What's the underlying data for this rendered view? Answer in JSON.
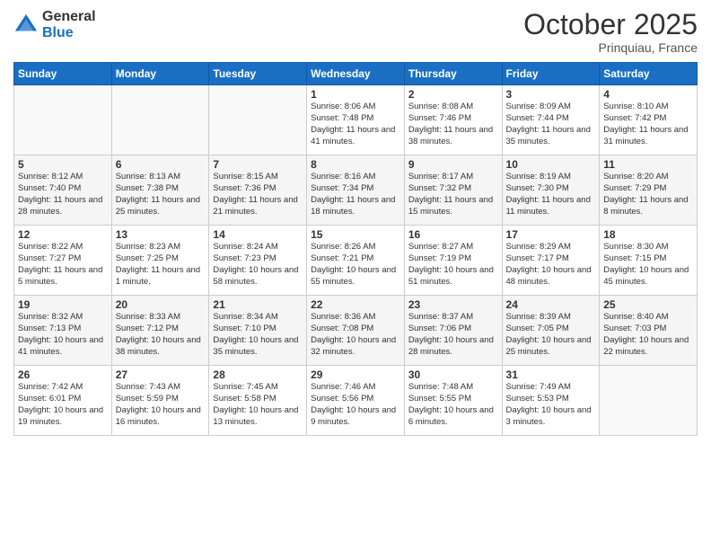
{
  "logo": {
    "general": "General",
    "blue": "Blue"
  },
  "header": {
    "month": "October 2025",
    "location": "Prinquiau, France"
  },
  "weekdays": [
    "Sunday",
    "Monday",
    "Tuesday",
    "Wednesday",
    "Thursday",
    "Friday",
    "Saturday"
  ],
  "weeks": [
    [
      {
        "day": "",
        "info": ""
      },
      {
        "day": "",
        "info": ""
      },
      {
        "day": "",
        "info": ""
      },
      {
        "day": "1",
        "info": "Sunrise: 8:06 AM\nSunset: 7:48 PM\nDaylight: 11 hours\nand 41 minutes."
      },
      {
        "day": "2",
        "info": "Sunrise: 8:08 AM\nSunset: 7:46 PM\nDaylight: 11 hours\nand 38 minutes."
      },
      {
        "day": "3",
        "info": "Sunrise: 8:09 AM\nSunset: 7:44 PM\nDaylight: 11 hours\nand 35 minutes."
      },
      {
        "day": "4",
        "info": "Sunrise: 8:10 AM\nSunset: 7:42 PM\nDaylight: 11 hours\nand 31 minutes."
      }
    ],
    [
      {
        "day": "5",
        "info": "Sunrise: 8:12 AM\nSunset: 7:40 PM\nDaylight: 11 hours\nand 28 minutes."
      },
      {
        "day": "6",
        "info": "Sunrise: 8:13 AM\nSunset: 7:38 PM\nDaylight: 11 hours\nand 25 minutes."
      },
      {
        "day": "7",
        "info": "Sunrise: 8:15 AM\nSunset: 7:36 PM\nDaylight: 11 hours\nand 21 minutes."
      },
      {
        "day": "8",
        "info": "Sunrise: 8:16 AM\nSunset: 7:34 PM\nDaylight: 11 hours\nand 18 minutes."
      },
      {
        "day": "9",
        "info": "Sunrise: 8:17 AM\nSunset: 7:32 PM\nDaylight: 11 hours\nand 15 minutes."
      },
      {
        "day": "10",
        "info": "Sunrise: 8:19 AM\nSunset: 7:30 PM\nDaylight: 11 hours\nand 11 minutes."
      },
      {
        "day": "11",
        "info": "Sunrise: 8:20 AM\nSunset: 7:29 PM\nDaylight: 11 hours\nand 8 minutes."
      }
    ],
    [
      {
        "day": "12",
        "info": "Sunrise: 8:22 AM\nSunset: 7:27 PM\nDaylight: 11 hours\nand 5 minutes."
      },
      {
        "day": "13",
        "info": "Sunrise: 8:23 AM\nSunset: 7:25 PM\nDaylight: 11 hours\nand 1 minute."
      },
      {
        "day": "14",
        "info": "Sunrise: 8:24 AM\nSunset: 7:23 PM\nDaylight: 10 hours\nand 58 minutes."
      },
      {
        "day": "15",
        "info": "Sunrise: 8:26 AM\nSunset: 7:21 PM\nDaylight: 10 hours\nand 55 minutes."
      },
      {
        "day": "16",
        "info": "Sunrise: 8:27 AM\nSunset: 7:19 PM\nDaylight: 10 hours\nand 51 minutes."
      },
      {
        "day": "17",
        "info": "Sunrise: 8:29 AM\nSunset: 7:17 PM\nDaylight: 10 hours\nand 48 minutes."
      },
      {
        "day": "18",
        "info": "Sunrise: 8:30 AM\nSunset: 7:15 PM\nDaylight: 10 hours\nand 45 minutes."
      }
    ],
    [
      {
        "day": "19",
        "info": "Sunrise: 8:32 AM\nSunset: 7:13 PM\nDaylight: 10 hours\nand 41 minutes."
      },
      {
        "day": "20",
        "info": "Sunrise: 8:33 AM\nSunset: 7:12 PM\nDaylight: 10 hours\nand 38 minutes."
      },
      {
        "day": "21",
        "info": "Sunrise: 8:34 AM\nSunset: 7:10 PM\nDaylight: 10 hours\nand 35 minutes."
      },
      {
        "day": "22",
        "info": "Sunrise: 8:36 AM\nSunset: 7:08 PM\nDaylight: 10 hours\nand 32 minutes."
      },
      {
        "day": "23",
        "info": "Sunrise: 8:37 AM\nSunset: 7:06 PM\nDaylight: 10 hours\nand 28 minutes."
      },
      {
        "day": "24",
        "info": "Sunrise: 8:39 AM\nSunset: 7:05 PM\nDaylight: 10 hours\nand 25 minutes."
      },
      {
        "day": "25",
        "info": "Sunrise: 8:40 AM\nSunset: 7:03 PM\nDaylight: 10 hours\nand 22 minutes."
      }
    ],
    [
      {
        "day": "26",
        "info": "Sunrise: 7:42 AM\nSunset: 6:01 PM\nDaylight: 10 hours\nand 19 minutes."
      },
      {
        "day": "27",
        "info": "Sunrise: 7:43 AM\nSunset: 5:59 PM\nDaylight: 10 hours\nand 16 minutes."
      },
      {
        "day": "28",
        "info": "Sunrise: 7:45 AM\nSunset: 5:58 PM\nDaylight: 10 hours\nand 13 minutes."
      },
      {
        "day": "29",
        "info": "Sunrise: 7:46 AM\nSunset: 5:56 PM\nDaylight: 10 hours\nand 9 minutes."
      },
      {
        "day": "30",
        "info": "Sunrise: 7:48 AM\nSunset: 5:55 PM\nDaylight: 10 hours\nand 6 minutes."
      },
      {
        "day": "31",
        "info": "Sunrise: 7:49 AM\nSunset: 5:53 PM\nDaylight: 10 hours\nand 3 minutes."
      },
      {
        "day": "",
        "info": ""
      }
    ]
  ]
}
